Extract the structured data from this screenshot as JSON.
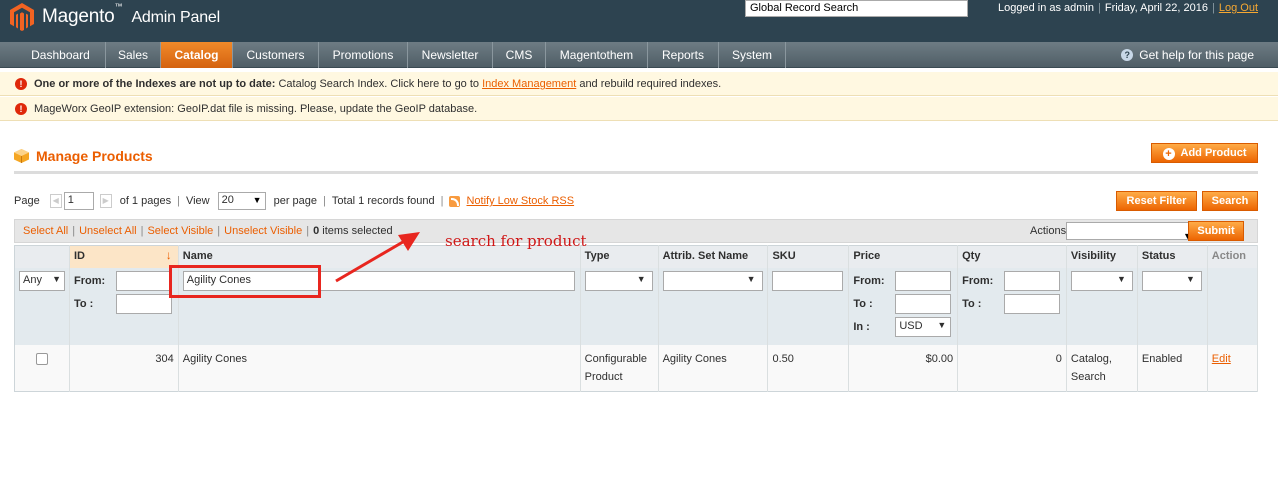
{
  "header": {
    "logo_text": "Magento",
    "logo_tm": "™",
    "logo_sub": "Admin Panel",
    "global_search_placeholder": "Global Record Search",
    "logged_in": "Logged in as admin",
    "date": "Friday, April 22, 2016",
    "logout": "Log Out"
  },
  "nav": {
    "items": [
      "Dashboard",
      "Sales",
      "Catalog",
      "Customers",
      "Promotions",
      "Newsletter",
      "CMS",
      "Magentothem",
      "Reports",
      "System"
    ],
    "active": "Catalog",
    "help": "Get help for this page"
  },
  "messages": {
    "index_bold": "One or more of the Indexes are not up to date:",
    "index_text": " Catalog Search Index. Click here to go to ",
    "index_link": "Index Management",
    "index_tail": " and rebuild required indexes.",
    "geoip": "MageWorx GeoIP extension: GeoIP.dat file is missing. Please, update the GeoIP database."
  },
  "page": {
    "title": "Manage Products",
    "add_button": "Add Product",
    "reset_filter": "Reset Filter",
    "search": "Search"
  },
  "pager": {
    "page_label": "Page",
    "page_value": "1",
    "of_pages": "of 1 pages",
    "view_label": "View",
    "per_page_value": "20",
    "per_page_label": "per page",
    "total": "Total 1 records found",
    "rss_link": "Notify Low Stock RSS"
  },
  "massaction": {
    "select_all": "Select All",
    "unselect_all": "Unselect All",
    "select_visible": "Select Visible",
    "unselect_visible": "Unselect Visible",
    "selected_count": "0",
    "selected_text": " items selected",
    "actions_label": "Actions",
    "submit": "Submit"
  },
  "grid": {
    "headers": [
      "",
      "ID",
      "Name",
      "Type",
      "Attrib. Set Name",
      "SKU",
      "Price",
      "Qty",
      "Visibility",
      "Status",
      "Action"
    ],
    "filters": {
      "any": "Any",
      "from": "From:",
      "to": "To :",
      "in": "In :",
      "name_value": "Agility Cones",
      "currency": "USD"
    },
    "rows": [
      {
        "id": "304",
        "name": "Agility Cones",
        "type_line1": "Configurable",
        "type_line2": "Product",
        "attrib_set": "Agility Cones",
        "sku": "0.50",
        "price": "$0.00",
        "qty": "0",
        "visibility_line1": "Catalog,",
        "visibility_line2": "Search",
        "status": "Enabled",
        "action": "Edit"
      }
    ]
  },
  "annotation": {
    "text": "search for product",
    "color": "#e8261f"
  },
  "colors": {
    "header_bg": "#2d4350",
    "accent": "#eb5e00",
    "button": "#ed6502"
  }
}
